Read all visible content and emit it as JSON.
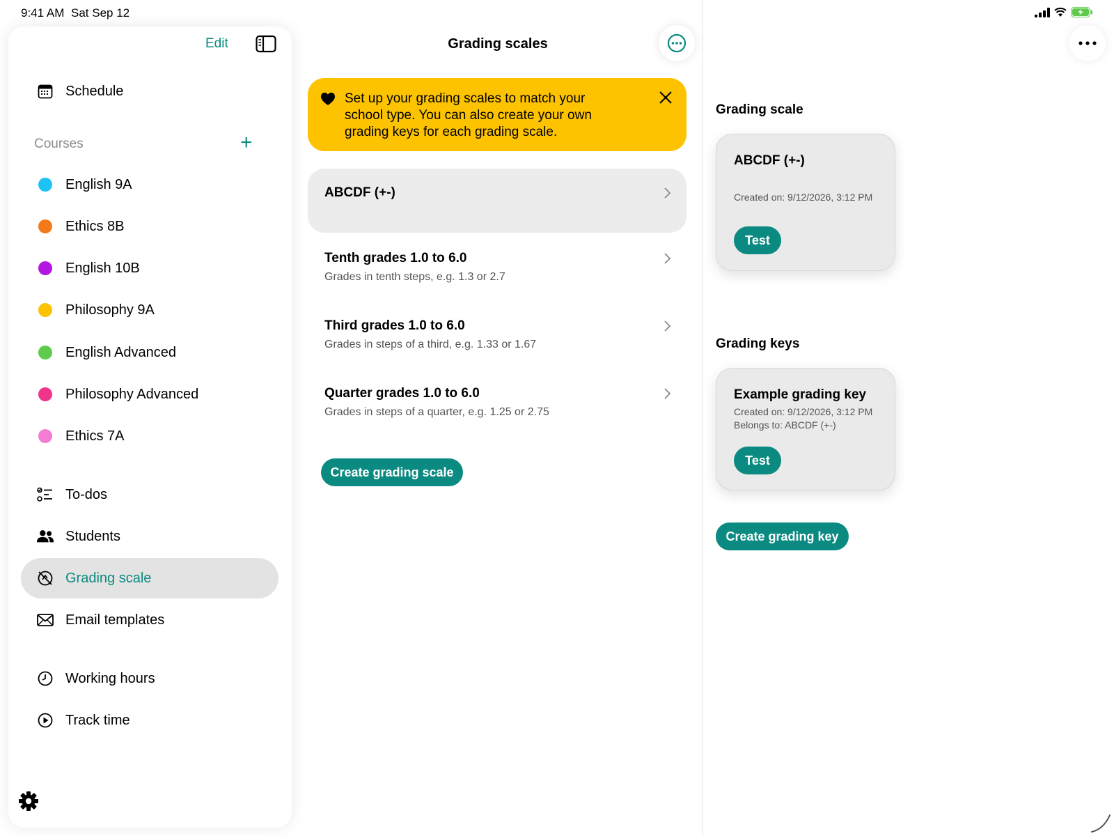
{
  "status": {
    "time": "9:41 AM",
    "date": "Sat Sep 12"
  },
  "sidebar": {
    "edit_label": "Edit",
    "schedule_label": "Schedule",
    "courses_header": "Courses",
    "courses": [
      {
        "label": "English 9A",
        "color": "#1ec3f5"
      },
      {
        "label": "Ethics 8B",
        "color": "#f37a1a"
      },
      {
        "label": "English 10B",
        "color": "#b316e0"
      },
      {
        "label": "Philosophy 9A",
        "color": "#fdc300"
      },
      {
        "label": "English Advanced",
        "color": "#5ecb4a"
      },
      {
        "label": "Philosophy Advanced",
        "color": "#f0348c"
      },
      {
        "label": "Ethics 7A",
        "color": "#f47dd3"
      }
    ],
    "todos_label": "To-dos",
    "students_label": "Students",
    "grading_label": "Grading scale",
    "email_label": "Email templates",
    "working_hours_label": "Working hours",
    "track_time_label": "Track time"
  },
  "middle": {
    "title": "Grading scales",
    "tip": "Set up your grading scales to match your school type. You can also create your own grading keys for each grading scale.",
    "scales": [
      {
        "title": "ABCDF (+-)",
        "subtitle": ""
      },
      {
        "title": "Tenth grades 1.0 to 6.0",
        "subtitle": "Grades in tenth steps, e.g. 1.3 or 2.7"
      },
      {
        "title": "Third grades 1.0 to 6.0",
        "subtitle": "Grades in steps of a third, e.g. 1.33 or 1.67"
      },
      {
        "title": "Quarter grades 1.0 to 6.0",
        "subtitle": "Grades in steps of a quarter, e.g. 1.25 or 2.75"
      }
    ],
    "create_label": "Create grading scale"
  },
  "right": {
    "scale_header": "Grading scale",
    "scale_card": {
      "title": "ABCDF (+-)",
      "created": "Created on: 9/12/2026, 3:12 PM",
      "test_label": "Test"
    },
    "keys_header": "Grading keys",
    "key_card": {
      "title": "Example grading key",
      "created": "Created on: 9/12/2026, 3:12 PM",
      "belongs": "Belongs to: ABCDF (+-)",
      "test_label": "Test"
    },
    "create_key_label": "Create grading key"
  },
  "colors": {
    "accent": "#0a8a80",
    "banner": "#fdc300"
  }
}
